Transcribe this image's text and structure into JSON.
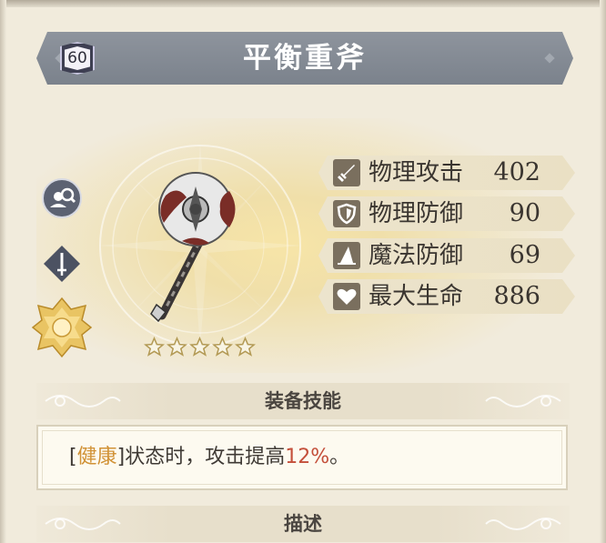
{
  "item": {
    "name": "平衡重斧",
    "level": "60",
    "rarity_stars": 5
  },
  "stats": [
    {
      "icon": "sword-icon",
      "label": "物理攻击",
      "value": "402"
    },
    {
      "icon": "shield-icon",
      "label": "物理防御",
      "value": "90"
    },
    {
      "icon": "wizard-hat-icon",
      "label": "魔法防御",
      "value": "69"
    },
    {
      "icon": "heart-icon",
      "label": "最大生命",
      "value": "886"
    }
  ],
  "side_buttons": [
    {
      "icon": "inspect-character-icon"
    },
    {
      "icon": "weapon-type-sword-icon"
    },
    {
      "icon": "golden-flower-emblem-icon"
    }
  ],
  "skill_section": {
    "title": "装备技能",
    "text_prefix": "[",
    "keyword": "健康",
    "text_middle": "]状态时，攻击提高",
    "percent": "12%",
    "text_suffix": "。"
  },
  "description_section": {
    "title": "描述"
  },
  "colors": {
    "banner": "#858b94",
    "keyword": "#d19236",
    "percent": "#c44f3a",
    "stat_icon_bg": "#7a6f5e"
  }
}
